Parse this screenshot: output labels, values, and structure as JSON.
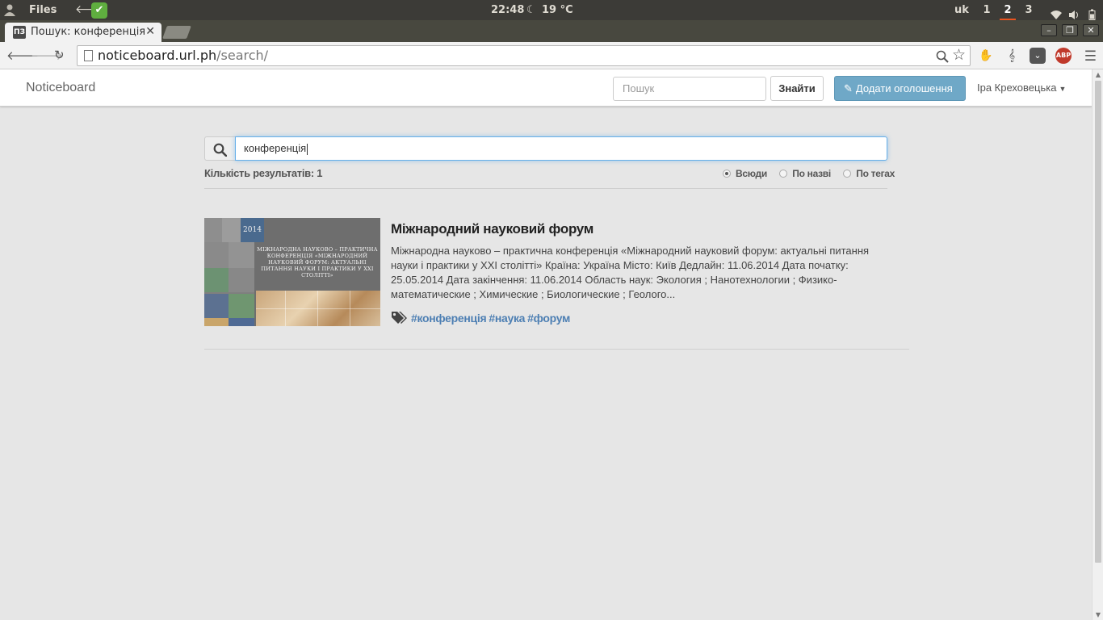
{
  "system_panel": {
    "files_label": "Files",
    "clock": "22:48",
    "weather": "19 °C",
    "language": "uk",
    "workspaces": [
      "1",
      "2",
      "3"
    ],
    "active_workspace": "2"
  },
  "browser": {
    "tab_title": "Пошук: конференція",
    "tab_favicon_text": "ПЗ",
    "url_host": "noticeboard.url.ph",
    "url_path": "/search/",
    "abp_label": "ABP"
  },
  "site_nav": {
    "brand": "Noticeboard",
    "search_placeholder": "Пошук",
    "find_button": "Знайти",
    "add_button": "Додати оголошення",
    "user_name": "Іра Креховецька"
  },
  "search": {
    "query": "конференція",
    "results_count_label": "Кількість результатів: 1",
    "filters": [
      "Всюди",
      "По назві",
      "По тегах"
    ],
    "selected_filter": "Всюди"
  },
  "results": [
    {
      "title": "Міжнародний науковий форум",
      "description": "Міжнародна науково – практична конференція «Міжнародний науковий форум: актуальні питання науки і практики у XXI столітті» Країна: Україна Місто: Київ Дедлайн: 11.06.2014 Дата початку: 25.05.2014 Дата закінчення: 11.06.2014 Область наук: Экология ; Нанотехнологии ; Физико-математические ; Химические ; Биологические ; Геолого...",
      "tags": [
        "#конференція",
        "#наука",
        "#форум"
      ],
      "thumb": {
        "year": "2014",
        "text": "МІЖНАРОДНА НАУКОВО – ПРАКТИЧНА КОНФЕРЕНЦІЯ «МІЖНАРОДНИЙ НАУКОВИЙ ФОРУМ: АКТУАЛЬНІ ПИТАННЯ НАУКИ І ПРАКТИКИ У XXI СТОЛІТТІ»"
      }
    }
  ],
  "colors": {
    "accent_button": "#6fa8c7",
    "tag_link": "#4d7fb3",
    "page_background": "#e6e6e6",
    "ubuntu_panel": "#3c3b37"
  },
  "icons": [
    "user-icon",
    "back-arrow-icon",
    "check-icon",
    "moon-icon",
    "wifi-icon",
    "volume-icon",
    "battery-icon",
    "search-icon",
    "star-icon",
    "pencil-icon",
    "tags-icon",
    "menu-icon"
  ]
}
